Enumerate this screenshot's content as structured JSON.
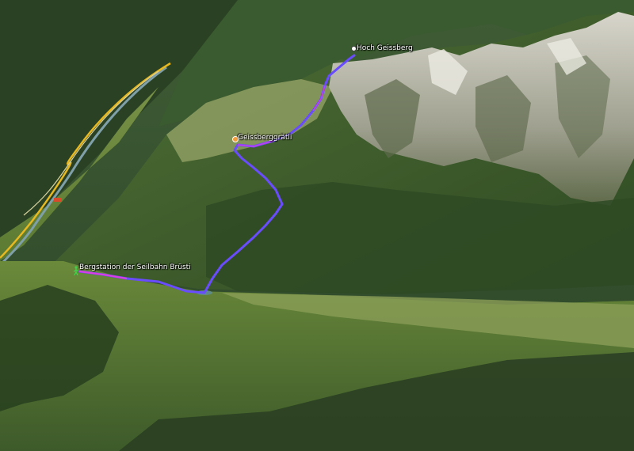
{
  "map": {
    "view": "3D satellite terrain, oblique view",
    "colors": {
      "route": "#6a4cff",
      "route_highlight": "#e03ce0",
      "road_main": "#e8b820",
      "road_secondary": "#d9d3a0",
      "river": "#7fa0a8",
      "meadow": "#6f8f3c",
      "forest": "#2c4a26",
      "rock": "#c9c8bd"
    },
    "labels": {
      "summit": "Hoch Geissberg",
      "saddle": "Geissberggrätli",
      "start": "Bergstation der Seilbahn Brüsti"
    },
    "icons": {
      "summit": "summit-pin-icon",
      "saddle": "waypoint-pin-icon",
      "start": "hiker-start-icon"
    }
  }
}
